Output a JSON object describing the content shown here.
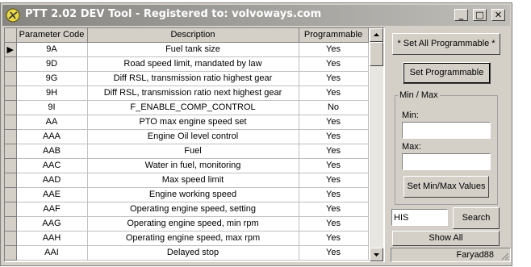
{
  "window": {
    "title": "PTT 2.02 DEV Tool - Registered to: volvoways.com",
    "minimize_glyph": "_",
    "maximize_glyph": "□",
    "close_glyph": "✕"
  },
  "grid": {
    "columns": [
      "Parameter Code",
      "Description",
      "Programmable"
    ],
    "current_row_marker": "▶",
    "rows": [
      {
        "code": "9A",
        "description": "Fuel tank size",
        "programmable": "Yes"
      },
      {
        "code": "9D",
        "description": "Road speed limit, mandated by law",
        "programmable": "Yes"
      },
      {
        "code": "9G",
        "description": "Diff RSL, transmission ratio highest gear",
        "programmable": "Yes"
      },
      {
        "code": "9H",
        "description": "Diff RSL, transmission ratio next highest gear",
        "programmable": "Yes"
      },
      {
        "code": "9I",
        "description": "F_ENABLE_COMP_CONTROL",
        "programmable": "No"
      },
      {
        "code": "AA",
        "description": "PTO max engine speed set",
        "programmable": "Yes"
      },
      {
        "code": "AAA",
        "description": "Engine Oil level control",
        "programmable": "Yes"
      },
      {
        "code": "AAB",
        "description": "Fuel",
        "programmable": "Yes"
      },
      {
        "code": "AAC",
        "description": "Water in fuel, monitoring",
        "programmable": "Yes"
      },
      {
        "code": "AAD",
        "description": "Max speed limit",
        "programmable": "Yes"
      },
      {
        "code": "AAE",
        "description": "Engine working speed",
        "programmable": "Yes"
      },
      {
        "code": "AAF",
        "description": "Operating engine speed, setting",
        "programmable": "Yes"
      },
      {
        "code": "AAG",
        "description": "Operating engine speed, min rpm",
        "programmable": "Yes"
      },
      {
        "code": "AAH",
        "description": "Operating engine speed, max rpm",
        "programmable": "Yes"
      },
      {
        "code": "AAI",
        "description": "Delayed stop",
        "programmable": "Yes"
      }
    ]
  },
  "side_panel": {
    "set_all_programmable": "* Set All Programmable *",
    "set_programmable": "Set Programmable",
    "minmax_group_label": "Min / Max",
    "min_label": "Min:",
    "min_value": "",
    "max_label": "Max:",
    "max_value": "",
    "set_minmax": "Set Min/Max Values",
    "search_value": "HIS",
    "search_button": "Search",
    "show_all": "Show All"
  },
  "status": {
    "user": "Faryad88"
  }
}
